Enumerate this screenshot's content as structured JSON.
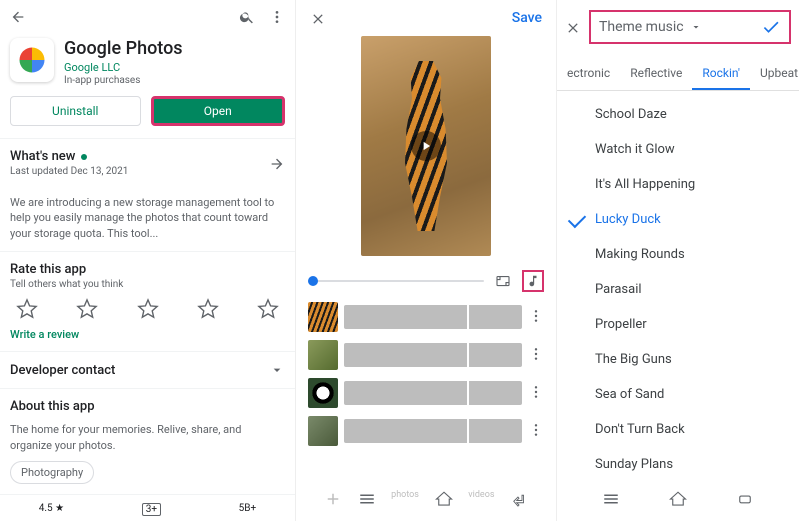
{
  "pane1": {
    "app_title": "Google Photos",
    "publisher": "Google LLC",
    "purchase_note": "In-app purchases",
    "uninstall": "Uninstall",
    "open": "Open",
    "whats_new_title": "What's new",
    "whats_new_sub": "Last updated Dec 13, 2021",
    "whats_new_desc": "We are introducing a new storage management tool to help you easily manage the photos that count toward your storage quota. This tool...",
    "rate_title": "Rate this app",
    "rate_sub": "Tell others what you think",
    "write_review": "Write a review",
    "dev_contact": "Developer contact",
    "about_title": "About this app",
    "about_desc": "The home for your memories. Relive, share, and organize your photos.",
    "category_chip": "Photography",
    "stats": {
      "rating": "4.5 ★",
      "age": "3+",
      "downloads": "5B+"
    }
  },
  "pane2": {
    "save": "Save",
    "bottom_text": "photos",
    "bottom_text2": "videos"
  },
  "pane3": {
    "dropdown_label": "Theme music",
    "tabs": [
      "ectronic",
      "Reflective",
      "Rockin'",
      "Upbeat"
    ],
    "active_tab": 2,
    "songs": [
      "School Daze",
      "Watch it Glow",
      "It's All Happening",
      "Lucky Duck",
      "Making Rounds",
      "Parasail",
      "Propeller",
      "The Big Guns",
      "Sea of Sand",
      "Don't Turn Back",
      "Sunday Plans"
    ],
    "selected_song": 3
  }
}
